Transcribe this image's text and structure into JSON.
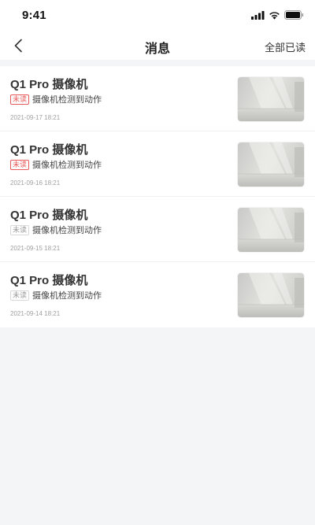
{
  "status_bar": {
    "time": "9:41"
  },
  "nav": {
    "title": "消息",
    "action_label": "全部已读"
  },
  "messages": [
    {
      "title": "Q1 Pro 摄像机",
      "badge": "未读",
      "unread": true,
      "description": "摄像机检测到动作",
      "time": "2021-09-17 18:21"
    },
    {
      "title": "Q1 Pro 摄像机",
      "badge": "未读",
      "unread": true,
      "description": "摄像机检测到动作",
      "time": "2021-09-16 18:21"
    },
    {
      "title": "Q1 Pro 摄像机",
      "badge": "未读",
      "unread": false,
      "description": "摄像机检测到动作",
      "time": "2021-09-15 18:21"
    },
    {
      "title": "Q1 Pro 摄像机",
      "badge": "未读",
      "unread": false,
      "description": "摄像机检测到动作",
      "time": "2021-09-14 18:21"
    }
  ],
  "colors": {
    "unread_badge": "#e85a5a",
    "read_badge": "#9a9a9a",
    "background": "#f4f5f7"
  }
}
